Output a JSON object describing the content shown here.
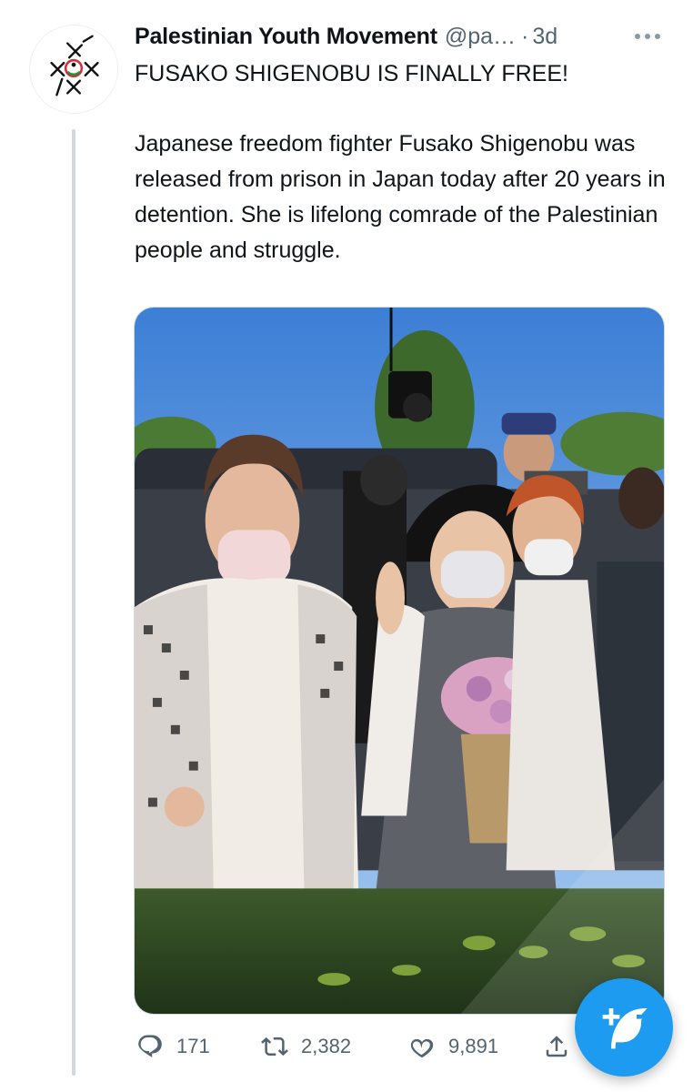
{
  "tweet": {
    "author": {
      "display_name": "Palestinian Youth Movement",
      "handle": "@pa…",
      "separator": "·",
      "timestamp": "3d"
    },
    "text": {
      "headline": "FUSAKO SHIGENOBU IS FINALLY FREE!",
      "body": "Japanese freedom fighter Fusako Shigenobu was released from prison in Japan today after 20 years in detention. She is lifelong comrade of the Palestinian people and struggle."
    },
    "media": {
      "kind": "photo"
    },
    "actions": {
      "reply_count": "171",
      "retweet_count": "2,382",
      "like_count": "9,891"
    }
  },
  "icons": {
    "more": "more-icon",
    "reply": "reply-icon",
    "retweet": "retweet-icon",
    "like": "heart-icon",
    "share": "share-icon",
    "compose": "compose-tweet-icon"
  },
  "colors": {
    "text_primary": "#0f1419",
    "text_secondary": "#536471",
    "accent": "#1d9bf0",
    "thread_line": "#cfd9de"
  }
}
